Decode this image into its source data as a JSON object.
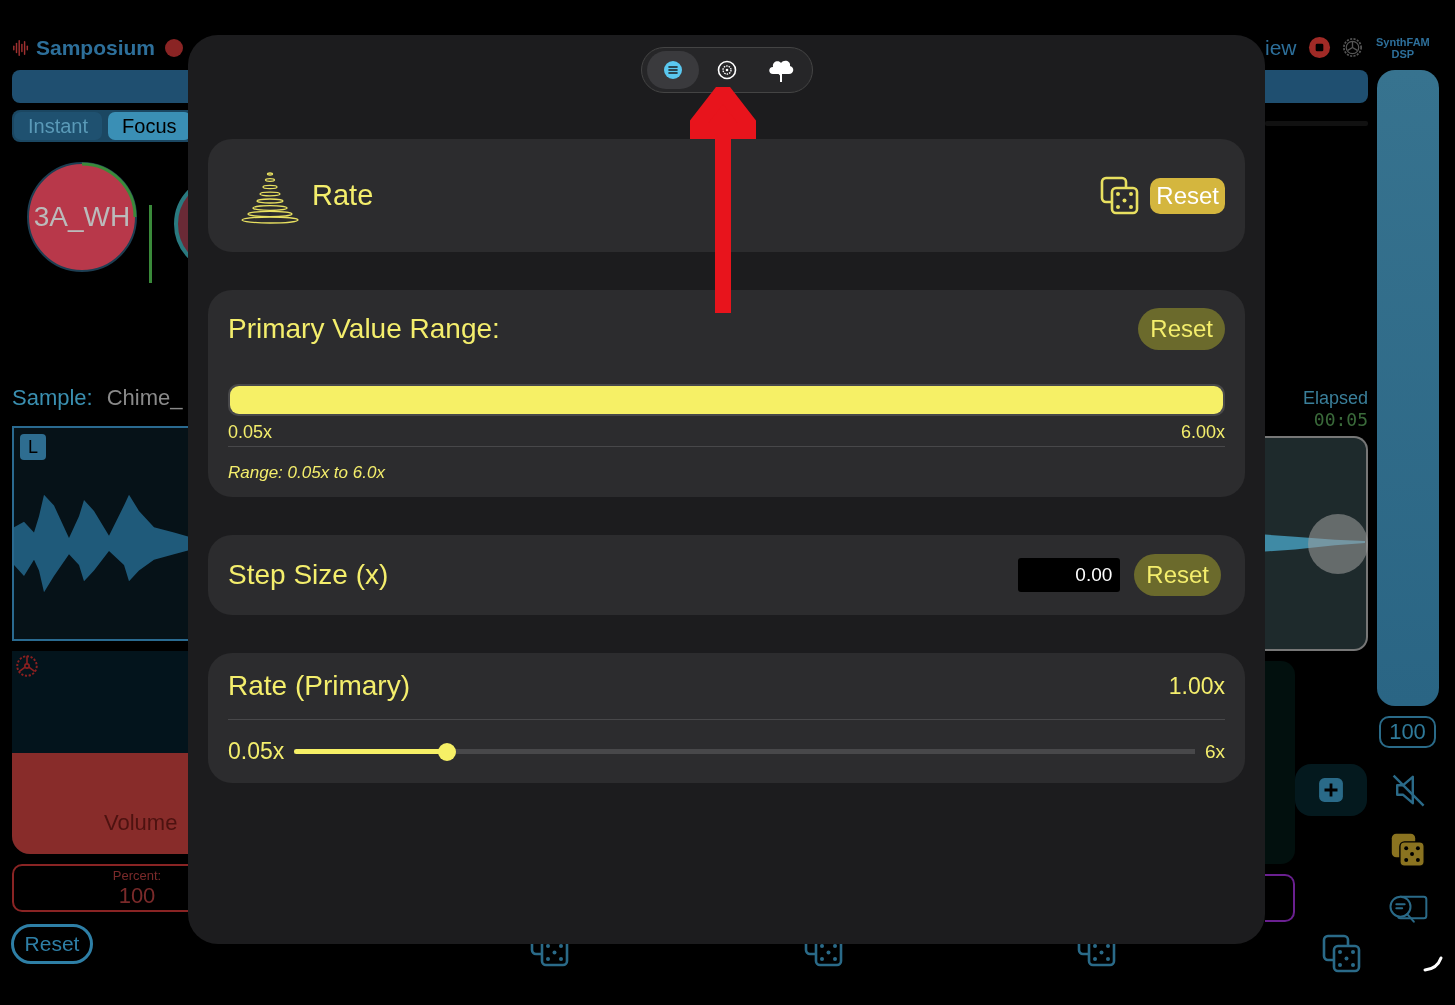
{
  "app_header": {
    "title": "Samposium"
  },
  "mode_tabs": [
    {
      "label": "Instant",
      "selected": false
    },
    {
      "label": "Focus",
      "selected": true
    }
  ],
  "knob": {
    "label": "3A_WH"
  },
  "sample": {
    "label": "Sample:",
    "name": "Chime_"
  },
  "waveform": {
    "channel": "L"
  },
  "volume": {
    "label": "Volume",
    "level": 0.5,
    "percent_label": "Percent:",
    "percent_value": "100"
  },
  "left_reset": "Reset",
  "right_header": {
    "view_label": "iew",
    "brand": "SynthFAM",
    "brand_sub": "DSP"
  },
  "elapsed": {
    "label": "Elapsed",
    "time": "00:05"
  },
  "output_level": "100",
  "modal": {
    "segments": [
      {
        "kind": "list",
        "selected": true
      },
      {
        "kind": "gear",
        "selected": false
      },
      {
        "kind": "tree",
        "selected": false
      }
    ],
    "header": {
      "title": "Rate",
      "reset": "Reset"
    },
    "range": {
      "title": "Primary Value Range:",
      "reset": "Reset",
      "level": 1,
      "min": "0.05x",
      "max": "6.00x",
      "note": "Range: 0.05x to 6.0x"
    },
    "step": {
      "title": "Step Size (x)",
      "value": "0.00",
      "reset": "Reset"
    },
    "rate": {
      "title": "Rate (Primary)",
      "value": "1.00x",
      "min": "0.05x",
      "max": "6x",
      "level": 0.17
    }
  }
}
